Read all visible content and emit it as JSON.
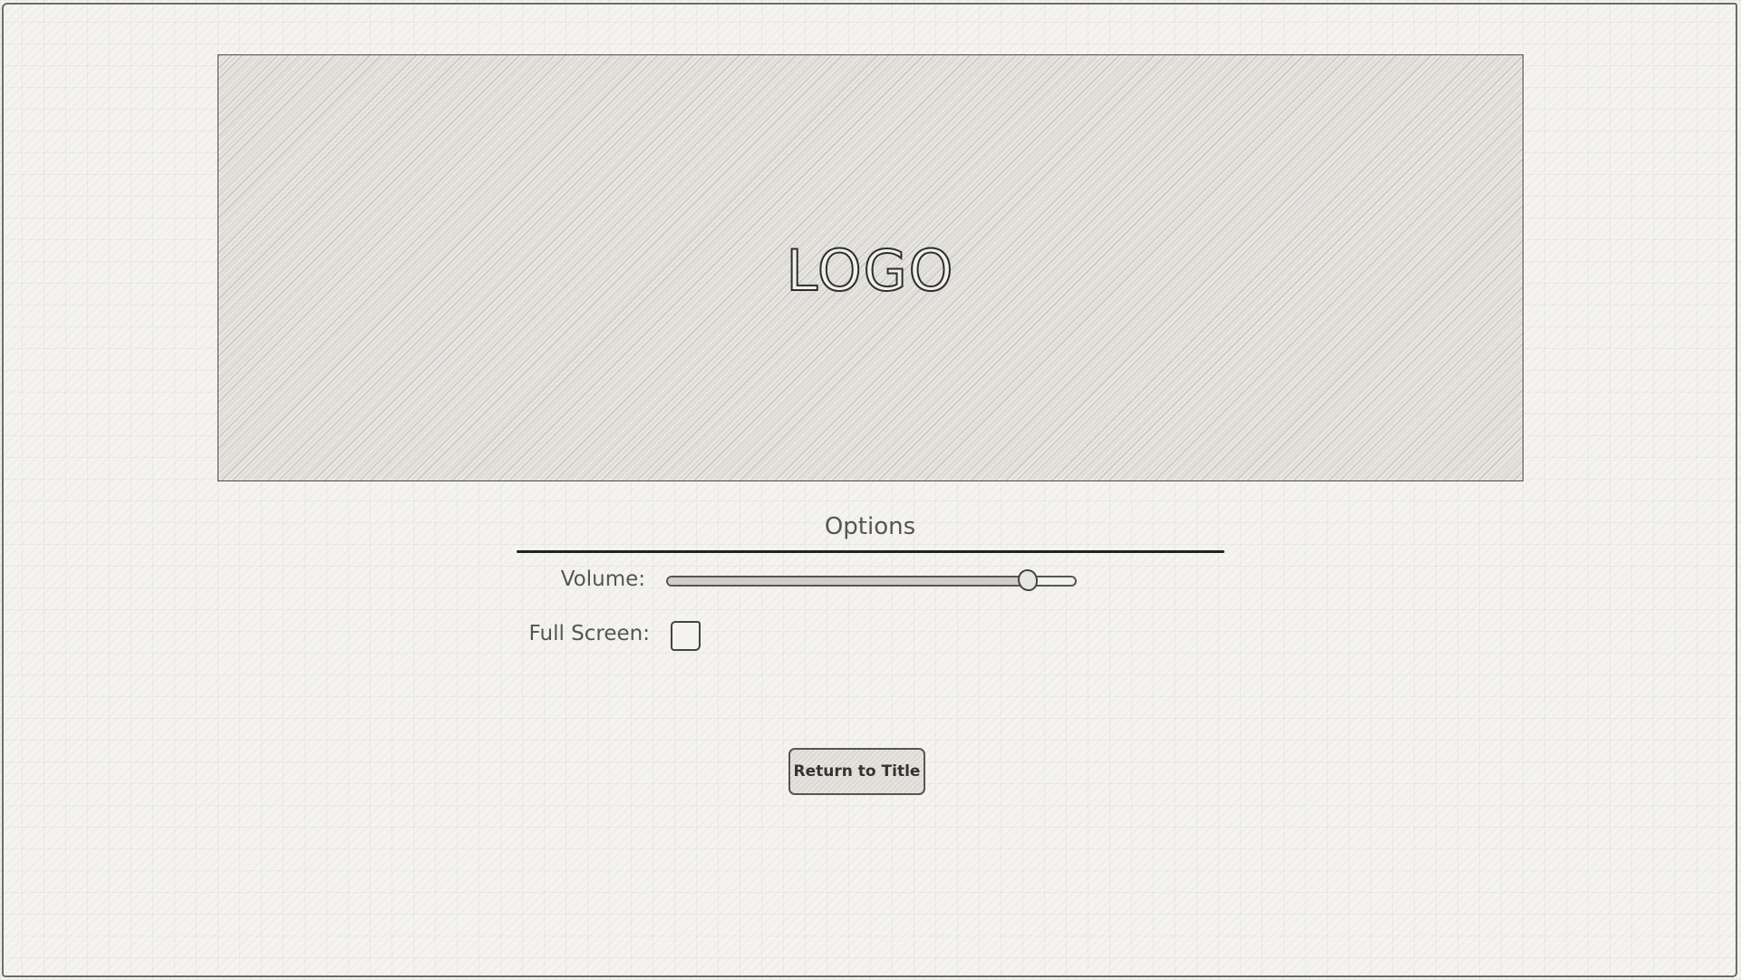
{
  "logo": {
    "text": "LOGO"
  },
  "options": {
    "title": "Options",
    "volume": {
      "label": "Volume:",
      "value": 0.88
    },
    "full_screen": {
      "label": "Full Screen:",
      "checked": false
    }
  },
  "buttons": {
    "return_to_title": "Return to Title"
  }
}
